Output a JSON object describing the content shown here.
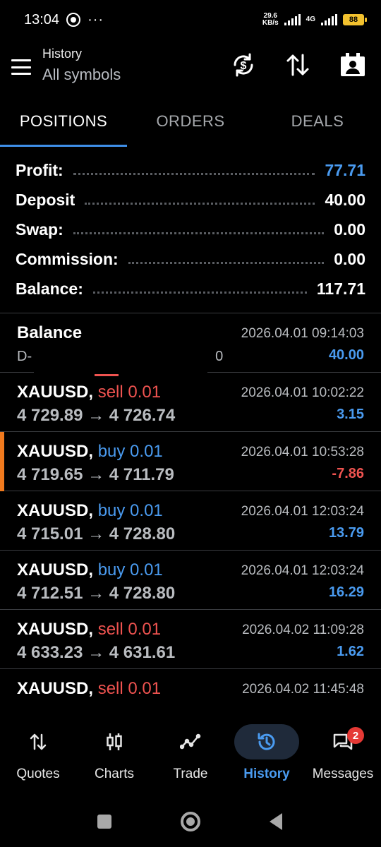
{
  "status_bar": {
    "time": "13:04",
    "net_speed_value": "29.6",
    "net_speed_unit": "KB/s",
    "network_type": "4G",
    "battery": "88"
  },
  "header": {
    "title": "History",
    "subtitle": "All symbols",
    "icons": [
      "menu-icon",
      "currency-sync-icon",
      "sort-icon",
      "account-card-icon"
    ]
  },
  "tabs": [
    {
      "label": "POSITIONS",
      "active": true
    },
    {
      "label": "ORDERS",
      "active": false
    },
    {
      "label": "DEALS",
      "active": false
    }
  ],
  "summary": {
    "profit_label": "Profit:",
    "profit_value": "77.71",
    "deposit_label": "Deposit",
    "deposit_value": "40.00",
    "swap_label": "Swap:",
    "swap_value": "0.00",
    "commission_label": "Commission:",
    "commission_value": "0.00",
    "balance_label": "Balance:",
    "balance_value": "117.71"
  },
  "balance_entry": {
    "title": "Balance",
    "account_start": "D-",
    "account_end": "0",
    "time": "2026.04.01 09:14:03",
    "amount": "40.00"
  },
  "positions": [
    {
      "symbol": "XAUUSD,",
      "side": "sell 0.01",
      "prices": "4 729.89 → 4 726.74",
      "time": "2026.04.01 10:02:22",
      "profit": "3.15"
    },
    {
      "symbol": "XAUUSD,",
      "side": "buy 0.01",
      "prices": "4 719.65 → 4 711.79",
      "time": "2026.04.01 10:53:28",
      "profit": "-7.86"
    },
    {
      "symbol": "XAUUSD,",
      "side": "buy 0.01",
      "prices": "4 715.01 → 4 728.80",
      "time": "2026.04.01 12:03:24",
      "profit": "13.79"
    },
    {
      "symbol": "XAUUSD,",
      "side": "buy 0.01",
      "prices": "4 712.51 → 4 728.80",
      "time": "2026.04.01 12:03:24",
      "profit": "16.29"
    },
    {
      "symbol": "XAUUSD,",
      "side": "sell 0.01",
      "prices": "4 633.23 → 4 631.61",
      "time": "2026.04.02 11:09:28",
      "profit": "1.62"
    },
    {
      "symbol": "XAUUSD,",
      "side": "sell 0.01",
      "prices": "",
      "time": "2026.04.02 11:45:48",
      "profit": ""
    }
  ],
  "bottom_nav": [
    {
      "label": "Quotes",
      "icon": "quotes-arrows-icon"
    },
    {
      "label": "Charts",
      "icon": "candlestick-icon"
    },
    {
      "label": "Trade",
      "icon": "trend-line-icon"
    },
    {
      "label": "History",
      "icon": "history-clock-icon",
      "active": true
    },
    {
      "label": "Messages",
      "icon": "messages-icon",
      "badge": "2"
    }
  ],
  "colors": {
    "accent": "#4a9bf0",
    "loss": "#ef5350",
    "marker": "#f07a1e",
    "background": "#000000"
  }
}
